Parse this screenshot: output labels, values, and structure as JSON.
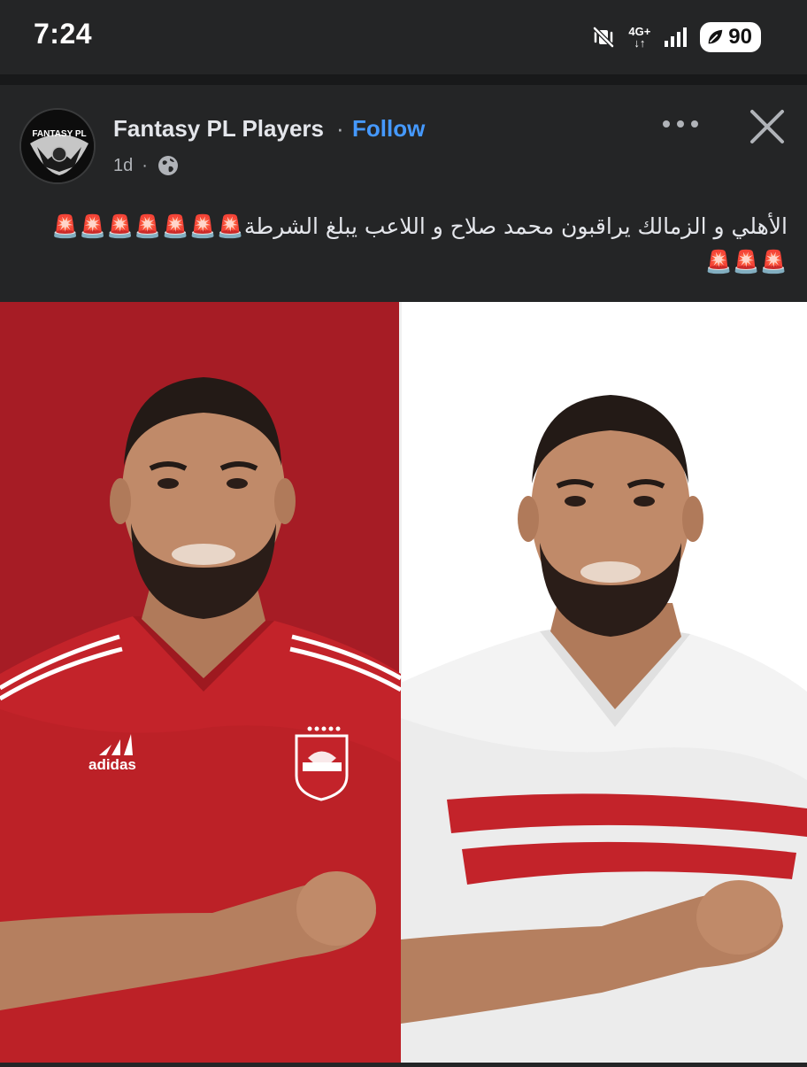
{
  "status_bar": {
    "time": "7:24",
    "network": "4G+",
    "network_arrows": "↓↑",
    "battery": "90",
    "icons": [
      "mute-vibrate-icon",
      "signal-icon",
      "leaf-icon"
    ]
  },
  "post": {
    "page_name": "Fantasy PL Players",
    "separator": "·",
    "follow_label": "Follow",
    "time_ago": "1d",
    "privacy_icon": "globe-icon",
    "caption": "الأهلي و الزمالك يراقبون محمد صلاح و اللاعب يبلغ الشرطة🚨🚨🚨🚨🚨🚨🚨🚨🚨🚨",
    "avatar_logo_text": "FANTASY PL"
  },
  "image": {
    "left_kit_brand": "adidas",
    "colors": {
      "left_background": "#a61c25",
      "right_background": "#ffffff",
      "red_kit": "#c3232a",
      "white_kit": "#f3f3f3"
    }
  },
  "colors": {
    "background": "#242526",
    "link_blue": "#4599ff",
    "text": "#e4e6eb",
    "muted": "#b0b3b8"
  }
}
